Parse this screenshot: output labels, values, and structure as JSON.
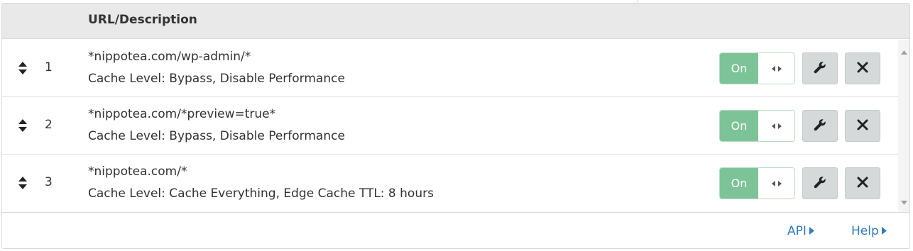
{
  "header": {
    "column_title": "URL/Description"
  },
  "rules": [
    {
      "number": "1",
      "url": "*nippotea.com/wp-admin/*",
      "description": "Cache Level: Bypass, Disable Performance",
      "toggle_label": "On"
    },
    {
      "number": "2",
      "url": "*nippotea.com/*preview=true*",
      "description": "Cache Level: Bypass, Disable Performance",
      "toggle_label": "On"
    },
    {
      "number": "3",
      "url": "*nippotea.com/*",
      "description": "Cache Level: Cache Everything, Edge Cache TTL: 8 hours",
      "toggle_label": "On"
    }
  ],
  "footer": {
    "api_label": "API",
    "help_label": "Help"
  },
  "icons": {
    "drag": "sort-arrows-icon",
    "toggle_knob": "left-right-arrows-icon",
    "edit": "wrench-icon",
    "delete": "close-icon",
    "link_caret": "caret-right-icon"
  },
  "colors": {
    "toggle_on": "#7cc497",
    "link": "#2f7bbf",
    "header_bg": "#e9e9e9",
    "button_bg": "#d5d9d9"
  }
}
